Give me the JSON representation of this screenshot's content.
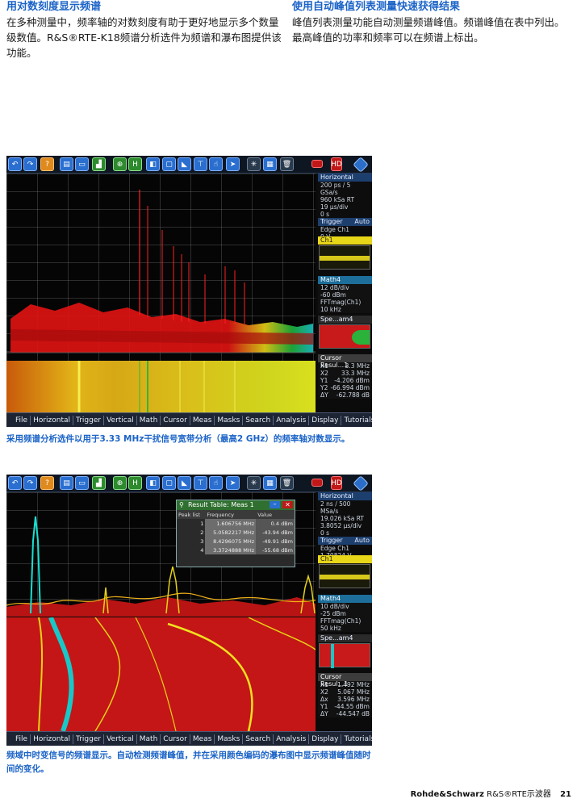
{
  "left_col": {
    "heading": "用对数刻度显示频谱",
    "body": "在多种测量中，频率轴的对数刻度有助于更好地显示多个数量级数值。R&S®RTE-K18频谱分析选件为频谱和瀑布图提供该功能。"
  },
  "right_col": {
    "heading": "使用自动峰值列表测量快速获得结果",
    "body": "峰值列表测量功能自动测量频谱峰值。频谱峰值在表中列出。最高峰值的功率和频率可以在频谱上标出。"
  },
  "screen1": {
    "horizontal": {
      "title": "Horizontal",
      "lines": [
        "200 ps / 5 GSa/s",
        "960 kSa    RT",
        "19 µs/div",
        "0 s"
      ]
    },
    "trigger": {
      "title": "Trigger",
      "mode": "Auto",
      "lines": [
        "Edge  Ch1",
        "0 V"
      ]
    },
    "ch1": "Ch1",
    "math": {
      "title": "Math4",
      "lines": [
        "12 dB/div",
        "-60 dBm",
        "FFTmag(Ch1)",
        "10 kHz"
      ]
    },
    "spec": "Spe...am4",
    "cursor": {
      "title": "Cursor Resul...1",
      "rows": [
        [
          "X1",
          "3.3 MHz"
        ],
        [
          "X2",
          "33.3 MHz"
        ],
        [
          "Y1",
          "-4.206 dBm"
        ],
        [
          "Y2",
          "-66.994 dBm"
        ],
        [
          "ΔY",
          "-62.788 dB"
        ]
      ]
    }
  },
  "screen2": {
    "horizontal": {
      "title": "Horizontal",
      "lines": [
        "2 ns / 500 MSa/s",
        "19.026 kSa    RT",
        "3.8052 µs/div",
        "0 s"
      ]
    },
    "trigger": {
      "title": "Trigger",
      "mode": "Auto",
      "lines": [
        "Edge  Ch1",
        "1.70824 V"
      ]
    },
    "ch1": "Ch1",
    "math": {
      "title": "Math4",
      "lines": [
        "10 dB/div",
        "-25 dBm",
        "FFTmag(Ch1)",
        "50 kHz"
      ]
    },
    "spec": "Spe...am4",
    "cursor": {
      "title": "Cursor Resul...1",
      "rows": [
        [
          "X1",
          "1.492 MHz"
        ],
        [
          "X2",
          "5.067 MHz"
        ],
        [
          "Δx",
          "3.596 MHz"
        ],
        [
          "Y1",
          "-44.55 dBm"
        ],
        [
          "ΔY",
          "-44.547 dB"
        ]
      ]
    },
    "result": {
      "title": "Result Table: Meas 1",
      "headers": [
        "Peak list",
        "Frequency",
        "Value"
      ],
      "rows": [
        [
          "1",
          "1.606756 MHz",
          "0.4 dBm"
        ],
        [
          "2",
          "5.0582217 MHz",
          "-43.94 dBm"
        ],
        [
          "3",
          "8.4296075 MHz",
          "-49.91 dBm"
        ],
        [
          "4",
          "3.3724888 MHz",
          "-55.68 dBm"
        ]
      ]
    }
  },
  "menubar": [
    "File",
    "Horizontal",
    "Trigger",
    "Vertical",
    "Math",
    "Cursor",
    "Meas",
    "Masks",
    "Search",
    "Analysis",
    "Display",
    "Tutorials"
  ],
  "caption1": "采用频谱分析选件以用于3.33 MHz干扰信号宽带分析（最高2 GHz）的频率轴对数显示。",
  "caption2": "频域中时变信号的频谱显示。自动检测频谱峰值，并在采用颜色编码的瀑布图中显示频谱峰值随时间的变化。",
  "footer": {
    "brand": "Rohde&Schwarz",
    "product": "R&S®RTE示波器",
    "page": "21"
  },
  "colors": {
    "accent": "#1b63c7",
    "trace": "#e01010",
    "waterfall_yellow": "#e8d619"
  }
}
